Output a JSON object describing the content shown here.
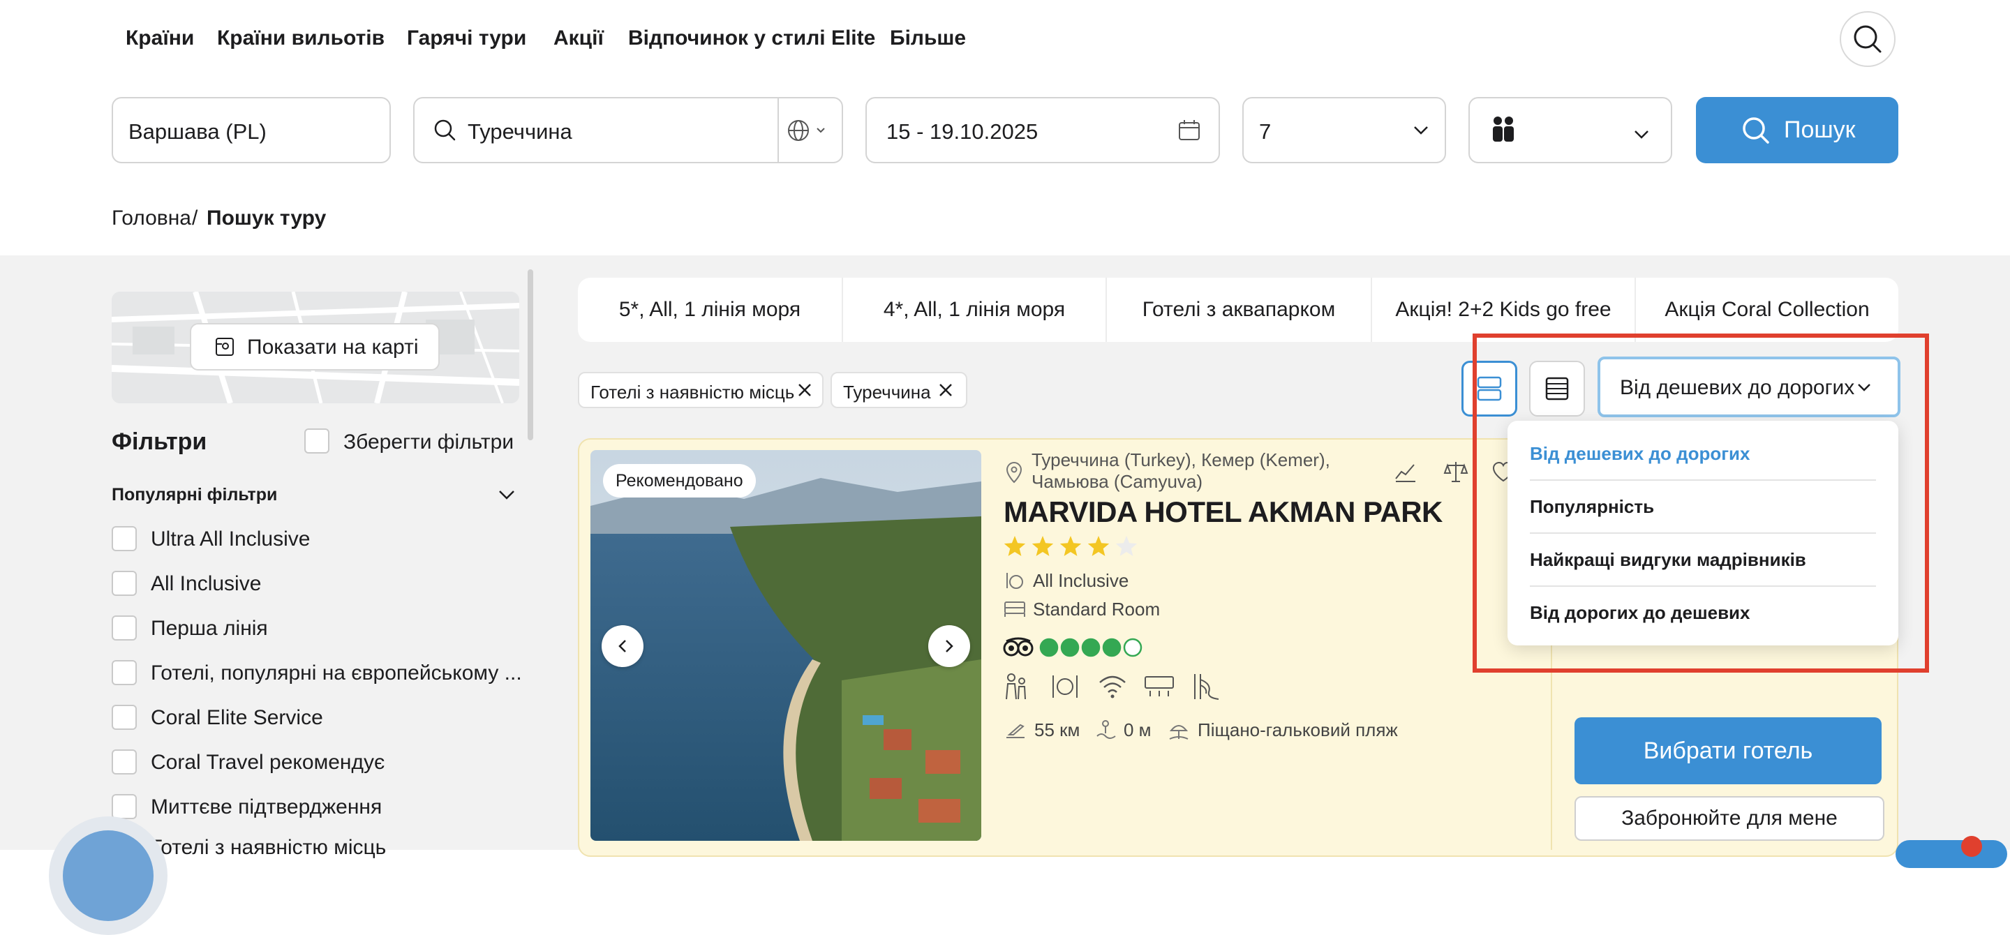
{
  "nav": {
    "items": [
      "Країни",
      "Країни вильотів",
      "Гарячі тури",
      "Акції",
      "Відпочинок у стилі Elite",
      "Більше"
    ]
  },
  "search": {
    "departure": "Варшава (PL)",
    "destination": "Туреччина",
    "dates": "15 - 19.10.2025",
    "nights": "7",
    "button_label": "Пошук"
  },
  "breadcrumb": {
    "home": "Головна",
    "separator": "/",
    "current": "Пошук туру"
  },
  "sidebar": {
    "map_button": "Показати на карті",
    "filters_title": "Фільтри",
    "save_filters": "Зберегти фільтри",
    "popular_title": "Популярні фільтри",
    "filters": [
      "Ultra All Inclusive",
      "All Inclusive",
      "Перша лінія",
      "Готелі, популярні на європейському ...",
      "Coral Elite Service",
      "Coral Travel рекомендує",
      "Миттєве підтвердження",
      "Готелі з наявністю місць"
    ]
  },
  "tabs": [
    "5*, All, 1 лінія моря",
    "4*, All, 1 лінія моря",
    "Готелі з аквапарком",
    "Акція! 2+2 Kids go free",
    "Акція Coral Collection"
  ],
  "chips": [
    "Готелі з наявністю місць",
    "Туреччина"
  ],
  "sort": {
    "selected": "Від дешевих до дорогих",
    "options": [
      "Від дешевих до дорогих",
      "Популярність",
      "Найкращі видгуки мадрівників",
      "Від дорогих до дешевих"
    ]
  },
  "hotel": {
    "badge": "Рекомендовано",
    "location": "Туреччина (Turkey), Кемер (Kemer), Чамьюва (Camyuva)",
    "name": "MARVIDA HOTEL AKMAN PARK",
    "stars": 4,
    "stars_max": 5,
    "tripadvisor_rating": 4,
    "tripadvisor_max": 5,
    "board": "All Inclusive",
    "room": "Standard Room",
    "airport_distance": "55 км",
    "beach_distance": "0 м",
    "beach_type": "Піщано-гальковий пляж",
    "choose_button": "Вибрати готель",
    "book_button": "Забронюйте для мене"
  },
  "colors": {
    "accent": "#3b8fd4",
    "highlight": "#e0402e",
    "star": "#f3c623",
    "tripadvisor": "#34a853",
    "card_bg": "#fdf7dc"
  }
}
